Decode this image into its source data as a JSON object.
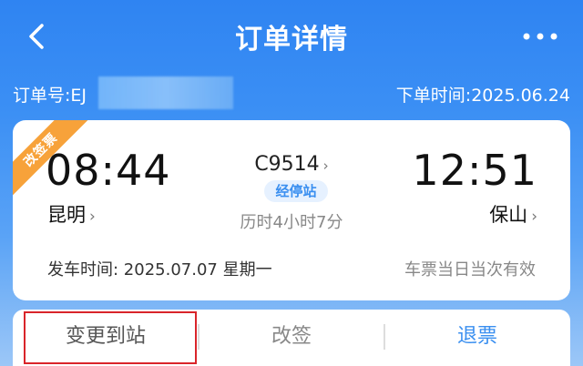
{
  "header": {
    "title": "订单详情",
    "back_icon": "chevron-left-icon",
    "more_icon": "more-dots-icon"
  },
  "order": {
    "order_no": "订单号:EJ",
    "order_time": "下单时间:2025.06.24"
  },
  "ticket": {
    "ribbon": "改签票",
    "departure": {
      "time": "08:44",
      "station": "昆明"
    },
    "arrival": {
      "time": "12:51",
      "station": "保山"
    },
    "train_no": "C9514",
    "stops_label": "经停站",
    "duration": "历时4小时7分",
    "depart_date": "发车时间:  2025.07.07 星期一",
    "validity": "车票当日当次有效",
    "chevron": "›"
  },
  "actions": {
    "change_station": "变更到站",
    "reschedule": "改签",
    "refund": "退票"
  },
  "colors": {
    "accent": "#3a8ff0",
    "ribbon": "#f7a23a",
    "highlight": "#d9252a"
  }
}
